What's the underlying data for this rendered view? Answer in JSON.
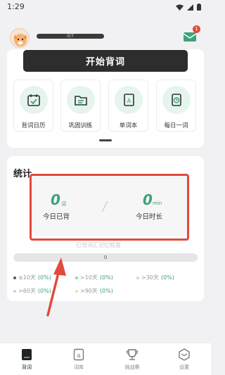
{
  "status": {
    "time": "1:29"
  },
  "header": {
    "progress_text": "0/7",
    "mail_badge": "1"
  },
  "main": {
    "start_label": "开始背词"
  },
  "features": [
    {
      "label": "背词日历",
      "icon": "calendar-check-icon"
    },
    {
      "label": "巩固训练",
      "icon": "folder-icon"
    },
    {
      "label": "单词本",
      "icon": "book-a-icon"
    },
    {
      "label": "每日一词",
      "icon": "clock-card-icon"
    }
  ],
  "stats": {
    "title": "统计",
    "today_words": {
      "value": "0",
      "unit": "词",
      "label": "今日已背"
    },
    "today_time": {
      "value": "0",
      "unit": "min",
      "label": "今日时长"
    },
    "divider": "/",
    "hint": "已背词汇记忆程度",
    "progress_label": "0",
    "legend": [
      {
        "label": "≤10天",
        "pct": "(0%)",
        "color": "#555555"
      },
      {
        "label": ">10天",
        "pct": "(0%)",
        "color": "#8fd3b6"
      },
      {
        "label": ">30天",
        "pct": "(0%)",
        "color": "#b7e3cf"
      },
      {
        "label": ">60天",
        "pct": "(0%)",
        "color": "#b6d7ea"
      },
      {
        "label": ">90天",
        "pct": "(0%)",
        "color": "#d9e9b4"
      }
    ]
  },
  "nav": [
    {
      "label": "背词",
      "icon": "book-icon"
    },
    {
      "label": "词库",
      "icon": "letter-a-icon"
    },
    {
      "label": "挑战赛",
      "icon": "trophy-icon"
    },
    {
      "label": "设置",
      "icon": "settings-hexagon-icon"
    }
  ],
  "colors": {
    "accent": "#3ea17a",
    "annotation": "#e24a3b",
    "button": "#2d2d2d"
  }
}
